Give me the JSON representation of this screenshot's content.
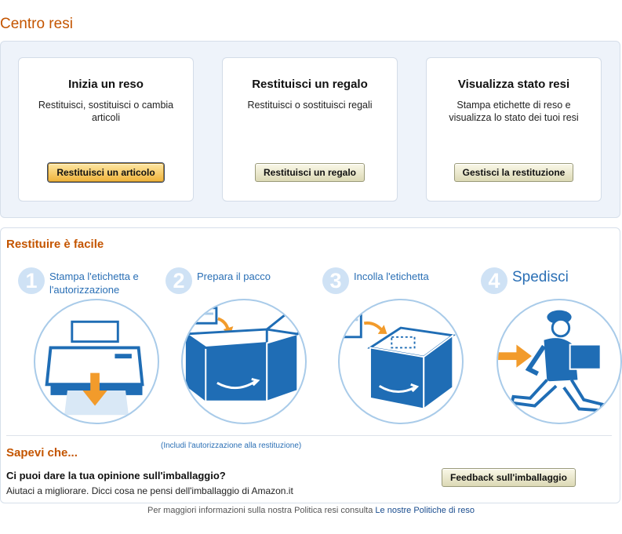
{
  "page_title": "Centro resi",
  "cards": [
    {
      "title": "Inizia un reso",
      "desc": "Restituisci, sostituisci o cambia articoli",
      "button": "Restituisci un articolo"
    },
    {
      "title": "Restituisci un regalo",
      "desc": "Restituisci o sostituisci regali",
      "button": "Restituisci un regalo"
    },
    {
      "title": "Visualizza stato resi",
      "desc": "Stampa etichette di reso e visualizza lo stato dei tuoi resi",
      "button": "Gestisci la restituzione"
    }
  ],
  "easy": {
    "title": "Restituire è facile",
    "steps": [
      {
        "num": "1",
        "label_line1": "Stampa l'etichetta e",
        "label_line2": "l'autorizzazione",
        "icon": "printer-icon"
      },
      {
        "num": "2",
        "label_line1": "Prepara il pacco",
        "label_line2": "",
        "icon": "open-box-icon",
        "note": "(Includi l'autorizzazione alla restituzione)"
      },
      {
        "num": "3",
        "label_line1": "Incolla l'etichetta",
        "label_line2": "",
        "icon": "closed-box-icon"
      },
      {
        "num": "4",
        "label_line1": "Spedisci",
        "label_line2": "",
        "icon": "courier-icon"
      }
    ]
  },
  "did_you_know": {
    "title": "Sapevi che...",
    "question": "Ci puoi dare la tua opinione sull'imballaggio?",
    "desc": "Aiutaci a migliorare. Dicci cosa ne pensi dell'imballaggio di Amazon.it",
    "button": "Feedback sull'imballaggio"
  },
  "footer": {
    "text": "Per maggiori informazioni sulla nostra Politica resi consulta",
    "link": "Le nostre Politiche di reso"
  },
  "colors": {
    "accent": "#c45500",
    "step_blue": "#2a6fb5",
    "box_blue": "#1f6db5",
    "arrow_orange": "#f29b2b"
  }
}
